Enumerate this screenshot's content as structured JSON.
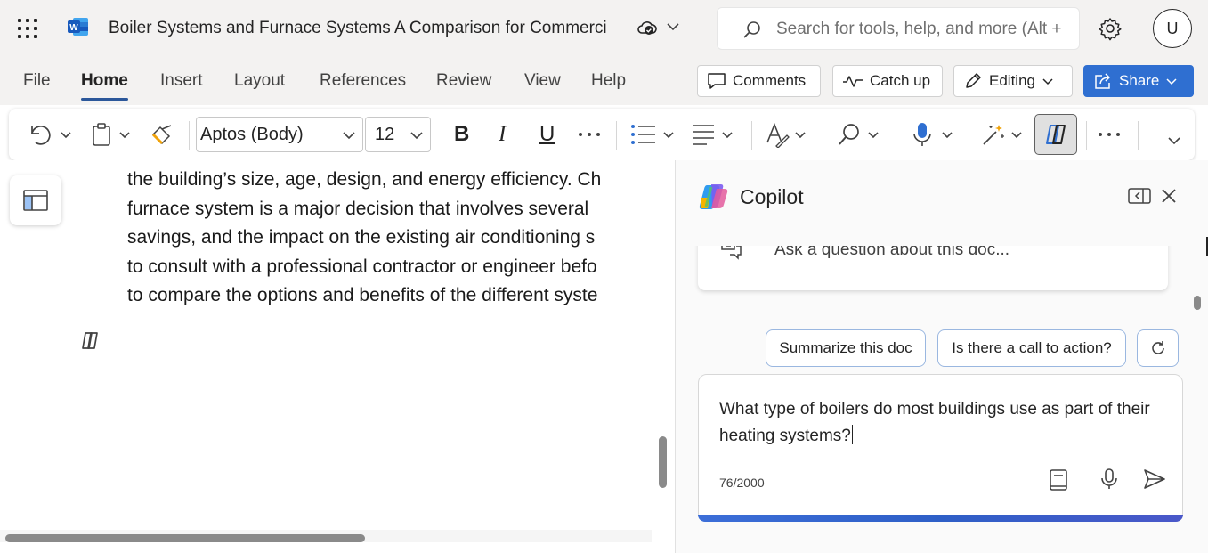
{
  "titlebar": {
    "doc_title": "Boiler Systems and Furnace Systems A Comparison for Commerci",
    "search_placeholder": "Search for tools, help, and more (Alt +",
    "avatar_initial": "U"
  },
  "ribbon": {
    "tabs": [
      {
        "label": "File"
      },
      {
        "label": "Home",
        "active": true
      },
      {
        "label": "Insert"
      },
      {
        "label": "Layout"
      },
      {
        "label": "References"
      },
      {
        "label": "Review"
      },
      {
        "label": "View"
      },
      {
        "label": "Help"
      }
    ],
    "comments_label": "Comments",
    "catchup_label": "Catch up",
    "editing_label": "Editing",
    "share_label": "Share"
  },
  "toolbar": {
    "font_name": "Aptos (Body)",
    "font_size": "12",
    "bold": "B",
    "italic": "I",
    "underline": "U"
  },
  "document": {
    "lines": [
      "the building’s size, age, design, and energy efficiency. Ch",
      "furnace system is a major decision that involves several",
      "savings, and the impact on the existing air conditioning s",
      "to consult with a professional contractor or engineer befo",
      "to compare the options and benefits of the different syste"
    ]
  },
  "copilot": {
    "title": "Copilot",
    "ask_placeholder": "Ask a question about this doc...",
    "suggestions": [
      "Summarize this doc",
      "Is there a call to action?"
    ],
    "question": "What type of boilers do most buildings use as part of their heating systems?",
    "counter": "76/2000"
  },
  "colors": {
    "accent": "#2f6fd1",
    "titlebar_bg": "#f3f2f1",
    "word_blue": "#185abd"
  }
}
